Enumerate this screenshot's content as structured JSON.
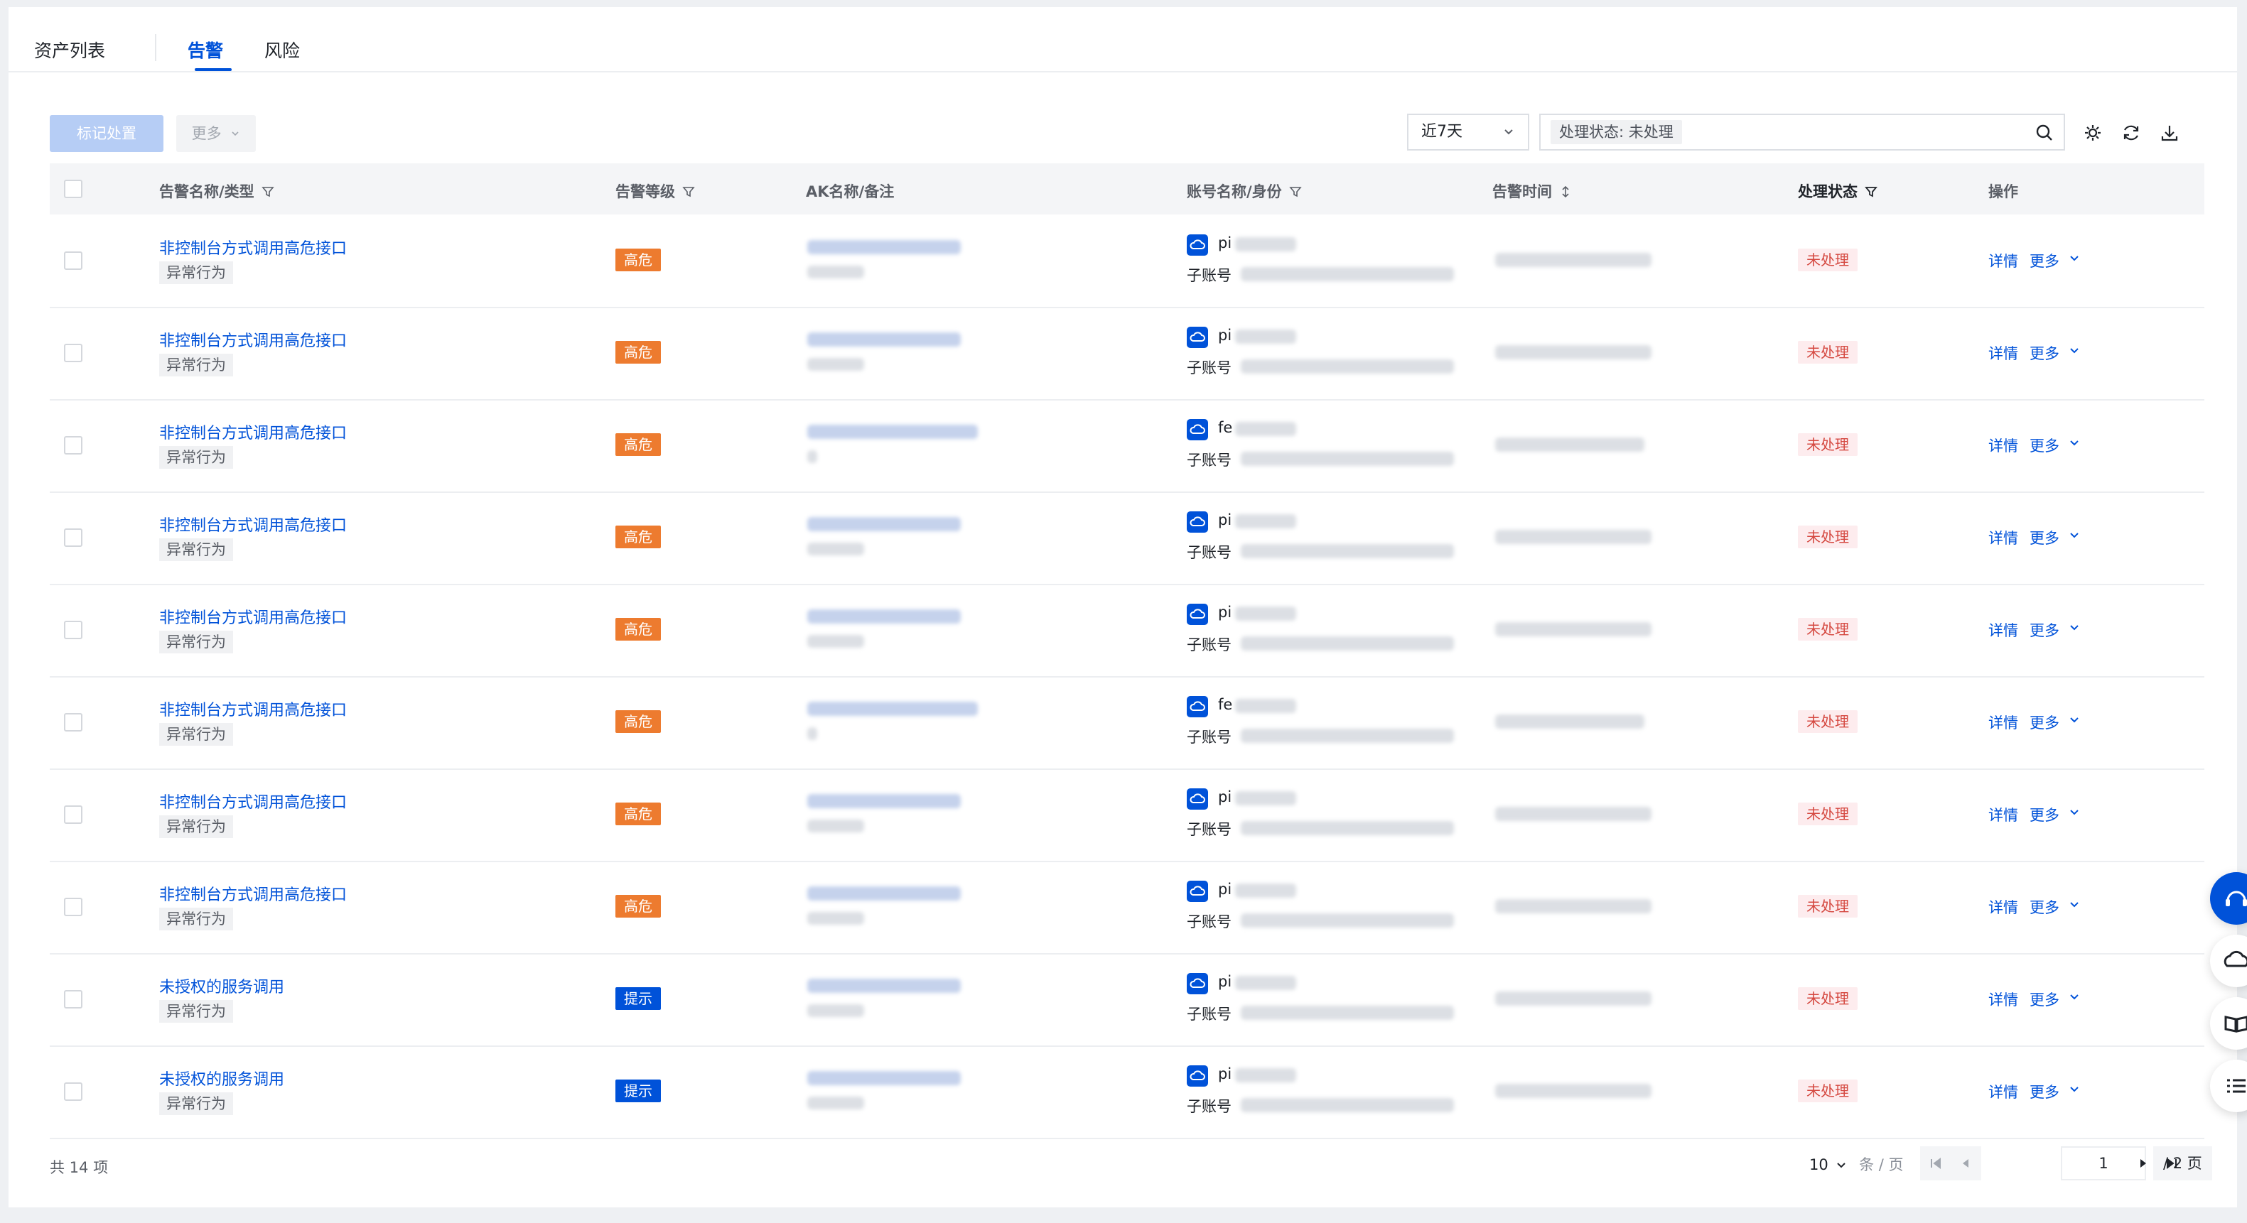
{
  "tabs": [
    {
      "label": "资产列表",
      "active": false
    },
    {
      "label": "告警",
      "active": true
    },
    {
      "label": "风险",
      "active": false
    }
  ],
  "toolbar": {
    "mark_label": "标记处置",
    "more_label": "更多",
    "time_range": "近7天",
    "filter_tag": "处理状态: 未处理"
  },
  "table": {
    "headers": {
      "name": "告警名称/类型",
      "level": "告警等级",
      "ak": "AK名称/备注",
      "account": "账号名称/身份",
      "time": "告警时间",
      "status": "处理状态",
      "ops": "操作"
    },
    "rows": [
      {
        "name": "非控制台方式调用高危接口",
        "type": "异常行为",
        "level": "高危",
        "acct_prefix": "pi",
        "acct_role": "子账号",
        "status": "未处理",
        "detail": "详情",
        "more": "更多"
      },
      {
        "name": "非控制台方式调用高危接口",
        "type": "异常行为",
        "level": "高危",
        "acct_prefix": "pi",
        "acct_role": "子账号",
        "status": "未处理",
        "detail": "详情",
        "more": "更多"
      },
      {
        "name": "非控制台方式调用高危接口",
        "type": "异常行为",
        "level": "高危",
        "acct_prefix": "fe",
        "acct_role": "子账号",
        "status": "未处理",
        "detail": "详情",
        "more": "更多"
      },
      {
        "name": "非控制台方式调用高危接口",
        "type": "异常行为",
        "level": "高危",
        "acct_prefix": "pi",
        "acct_role": "子账号",
        "status": "未处理",
        "detail": "详情",
        "more": "更多"
      },
      {
        "name": "非控制台方式调用高危接口",
        "type": "异常行为",
        "level": "高危",
        "acct_prefix": "pi",
        "acct_role": "子账号",
        "status": "未处理",
        "detail": "详情",
        "more": "更多"
      },
      {
        "name": "非控制台方式调用高危接口",
        "type": "异常行为",
        "level": "高危",
        "acct_prefix": "fe",
        "acct_role": "子账号",
        "status": "未处理",
        "detail": "详情",
        "more": "更多"
      },
      {
        "name": "非控制台方式调用高危接口",
        "type": "异常行为",
        "level": "高危",
        "acct_prefix": "pi",
        "acct_role": "子账号",
        "status": "未处理",
        "detail": "详情",
        "more": "更多"
      },
      {
        "name": "非控制台方式调用高危接口",
        "type": "异常行为",
        "level": "高危",
        "acct_prefix": "pi",
        "acct_role": "子账号",
        "status": "未处理",
        "detail": "详情",
        "more": "更多"
      },
      {
        "name": "未授权的服务调用",
        "type": "异常行为",
        "level": "提示",
        "acct_prefix": "pi",
        "acct_role": "子账号",
        "status": "未处理",
        "detail": "详情",
        "more": "更多"
      },
      {
        "name": "未授权的服务调用",
        "type": "异常行为",
        "level": "提示",
        "acct_prefix": "pi",
        "acct_role": "子账号",
        "status": "未处理",
        "detail": "详情",
        "more": "更多"
      }
    ]
  },
  "pagination": {
    "total": "共 14 项",
    "page_size": "10",
    "page_size_unit": "条 / 页",
    "current_page": "1",
    "total_pages": "/ 2 页"
  },
  "colors": {
    "primary": "#0052d9",
    "high": "#ed7b2f",
    "hint": "#0052d9",
    "status_bg": "#fdecee",
    "status_text": "#d54941"
  },
  "icons": [
    "search-icon",
    "gear-icon",
    "refresh-icon",
    "download-icon",
    "filter-icon",
    "sort-icon",
    "cloud-icon",
    "chevron-down-icon",
    "headset-icon",
    "book-icon",
    "list-icon"
  ]
}
